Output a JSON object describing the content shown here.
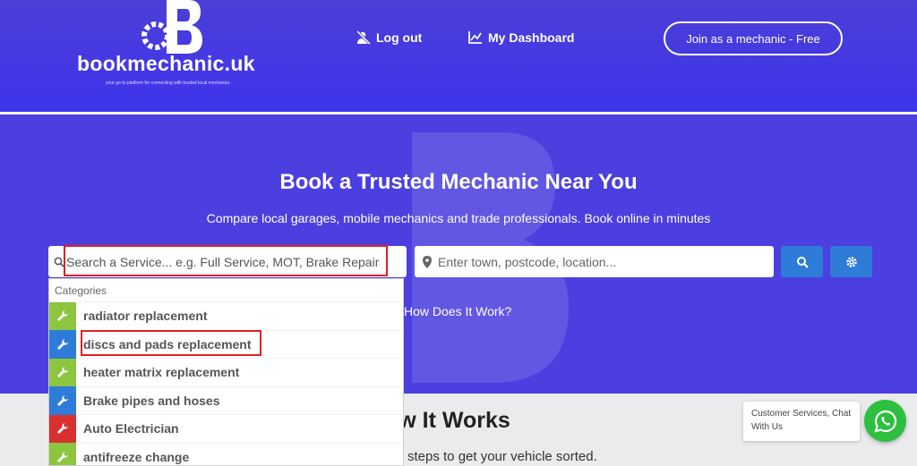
{
  "header": {
    "logo_text": "bookmechanic.uk",
    "logo_tagline": "your go-to platform for connecting with trusted local mechanics",
    "nav": [
      {
        "label": "Log out",
        "icon": "logout-icon"
      },
      {
        "label": "My Dashboard",
        "icon": "chart-icon"
      }
    ],
    "join_button": "Join as a mechanic - Free"
  },
  "hero": {
    "title": "Book a Trusted Mechanic Near You",
    "subtitle": "Compare local garages, mobile mechanics and trade professionals. Book online in minutes",
    "search_placeholder": "Search a Service... e.g. Full Service, MOT, Brake Repair",
    "location_placeholder": "Enter town, postcode, location...",
    "how_link": "How Does It Work?"
  },
  "dropdown": {
    "heading": "Categories",
    "items": [
      {
        "label": "radiator replacement",
        "color": "#8cc63f"
      },
      {
        "label": "discs and pads replacement",
        "color": "#2e7bd8"
      },
      {
        "label": "heater matrix replacement",
        "color": "#8cc63f"
      },
      {
        "label": "Brake pipes and hoses",
        "color": "#2e7bd8"
      },
      {
        "label": "Auto Electrician",
        "color": "#d93030"
      },
      {
        "label": "antifreeze change",
        "color": "#8cc63f"
      }
    ]
  },
  "lower": {
    "title_fragment": "ow It Works",
    "text_fragment": "steps to get your vehicle sorted."
  },
  "chat": {
    "text": "Customer Services, Chat With Us",
    "icon": "whatsapp-icon"
  },
  "colors": {
    "primary": "#4b3fe0",
    "button": "#2e7bd8",
    "whatsapp": "#2dbf3f"
  }
}
